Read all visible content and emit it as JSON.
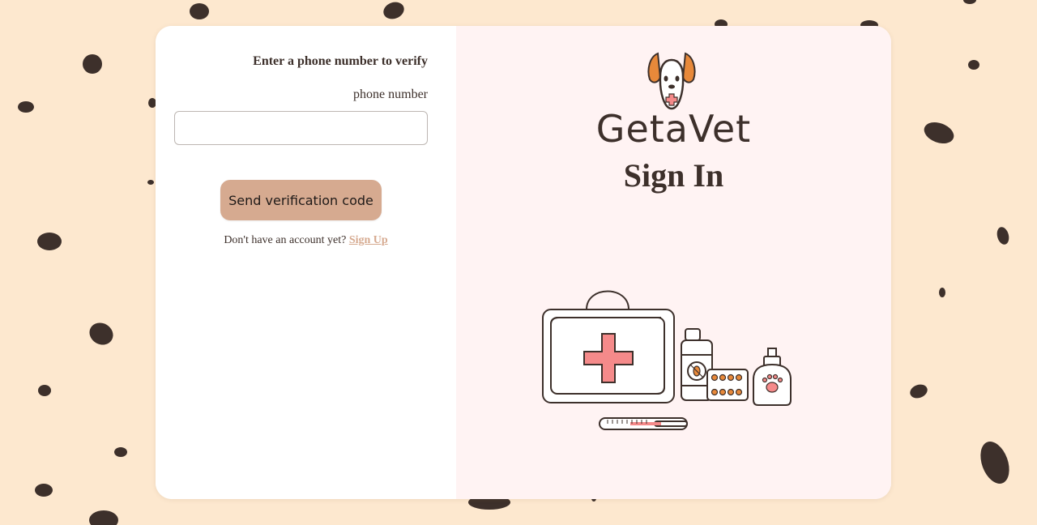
{
  "form": {
    "heading": "Enter a phone number to verify",
    "phone_label": "phone number",
    "phone_value": "",
    "phone_placeholder": "",
    "send_button_label": "Send verification code",
    "no_account_text": "Don't have an account yet?",
    "signup_link_label": "Sign Up"
  },
  "brand_panel": {
    "brand_name": "GetaVet",
    "title": "Sign In",
    "logo_icon": "dog-face-icon",
    "illustration_icon": "vet-medical-kit-icon"
  },
  "colors": {
    "page_background": "#fde8cf",
    "spots": "#3d302b",
    "right_panel": "#fff3f3",
    "button": "#d6aa90",
    "link": "#d6aa90",
    "text": "#3d302b",
    "cross_red": "#f58a8a",
    "ear_orange": "#e8893a"
  }
}
